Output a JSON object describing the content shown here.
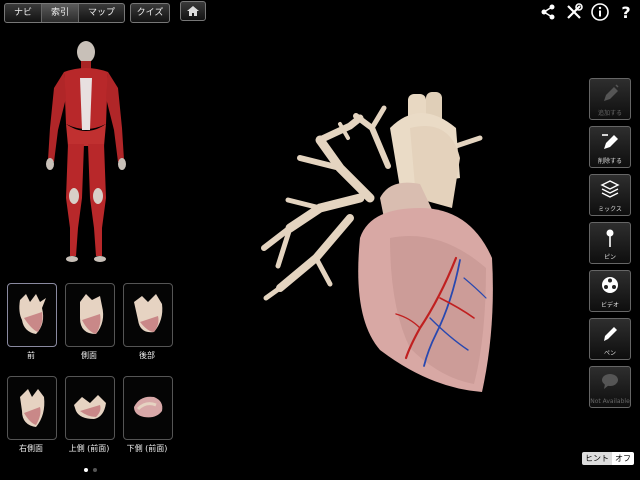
{
  "nav_tabs": [
    {
      "label": "ナビ",
      "active": false
    },
    {
      "label": "索引",
      "active": true
    },
    {
      "label": "マップ",
      "active": false
    }
  ],
  "quiz_label": "クイズ",
  "top_icons": [
    "home-icon",
    "share-icon",
    "tools-icon",
    "info-icon",
    "help-icon"
  ],
  "views": [
    {
      "label": "前",
      "selected": true
    },
    {
      "label": "側面",
      "selected": false
    },
    {
      "label": "後部",
      "selected": false
    },
    {
      "label": "右側面",
      "selected": false
    },
    {
      "label": "上側 (前面)",
      "selected": false
    },
    {
      "label": "下側 (前面)",
      "selected": false
    }
  ],
  "tools": [
    {
      "label": "追加する",
      "icon": "add-pen-icon",
      "enabled": false
    },
    {
      "label": "削除する",
      "icon": "remove-pen-icon",
      "enabled": true
    },
    {
      "label": "ミックス",
      "icon": "layers-icon",
      "enabled": true
    },
    {
      "label": "ピン",
      "icon": "pin-icon",
      "enabled": true
    },
    {
      "label": "ビデオ",
      "icon": "video-reel-icon",
      "enabled": true
    },
    {
      "label": "ペン",
      "icon": "pen-icon",
      "enabled": true
    },
    {
      "label": "Not Available",
      "icon": "speech-bubble-icon",
      "enabled": false
    }
  ],
  "hint": {
    "label": "ヒント",
    "state": "オフ"
  },
  "pager": {
    "pages": 2,
    "current": 1
  },
  "colors": {
    "background": "#000000",
    "muscle": "#b8282a",
    "heart": "#e8d8c8",
    "artery": "#c02020",
    "vein": "#2848b0"
  }
}
